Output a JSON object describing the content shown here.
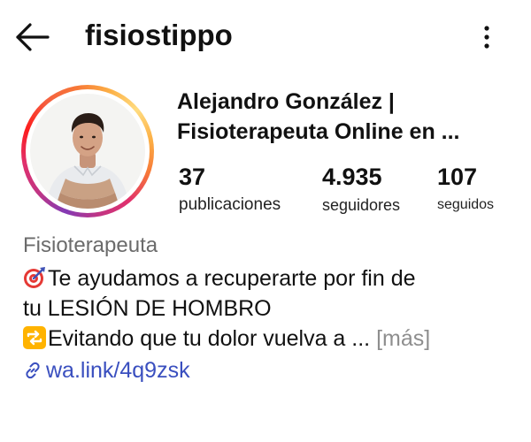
{
  "header": {
    "username": "fisiostippo",
    "back_icon": "arrow-left-icon",
    "more_icon": "more-vertical-icon"
  },
  "profile": {
    "display_name_line1": "Alejandro González |",
    "display_name_line2": "Fisioterapeuta Online en ...",
    "avatar_ring_colors": [
      "#833ab4",
      "#e1306c",
      "#f77737",
      "#fcaf45"
    ],
    "stats": [
      {
        "value": "37",
        "label": "publicaciones"
      },
      {
        "value": "4.935",
        "label": "seguidores"
      },
      {
        "value": "107",
        "label": "seguidos"
      }
    ],
    "category": "Fisioterapeuta",
    "bio": {
      "line1_emoji": "🎯",
      "line1_text": "Te ayudamos a recuperarte por fin de",
      "line2_text": "tu LESIÓN DE HOMBRO",
      "line3_emoji": "🔁",
      "line3_text": "Evitando que tu dolor vuelva a ... ",
      "more_label": "[más]"
    },
    "link": {
      "icon": "link-icon",
      "text": "wa.link/4q9zsk",
      "color": "#3a4fbf"
    }
  }
}
